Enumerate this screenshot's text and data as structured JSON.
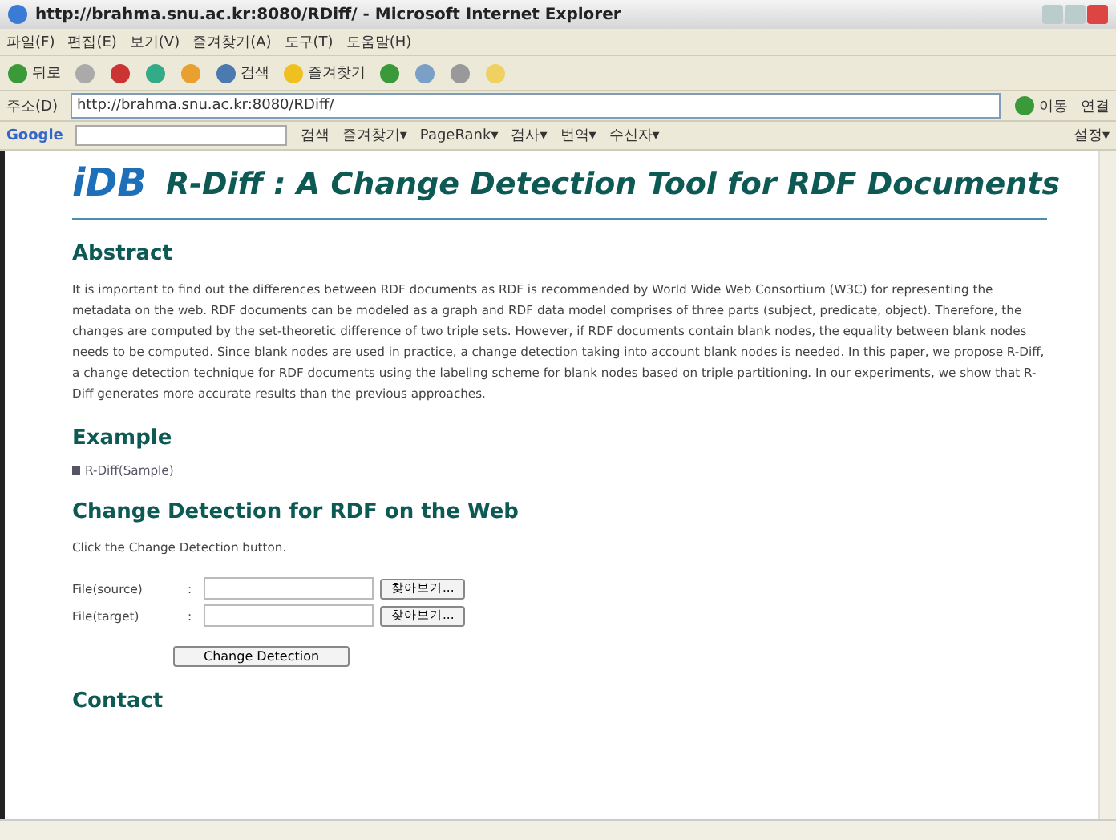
{
  "window": {
    "title": "http://brahma.snu.ac.kr:8080/RDiff/ - Microsoft Internet Explorer"
  },
  "menu": [
    "파일(F)",
    "편집(E)",
    "보기(V)",
    "즐겨찾기(A)",
    "도구(T)",
    "도움말(H)"
  ],
  "toolbar": {
    "back": "뒤로",
    "search": "검색",
    "favorites": "즐겨찾기"
  },
  "address_bar": {
    "label": "주소(D)",
    "value": "http://brahma.snu.ac.kr:8080/RDiff/",
    "go": "이동",
    "links": "연결"
  },
  "google_bar": {
    "brand": "Google",
    "items": [
      "검색",
      "즐겨찾기▾",
      "PageRank▾",
      "검사▾",
      "번역▾",
      "수신자▾"
    ],
    "settings": "설정▾"
  },
  "page": {
    "logo": "iDB",
    "title": "R-Diff : A Change Detection Tool for RDF Documents",
    "sections": [
      {
        "kind": "text",
        "heading": "Abstract",
        "text": "It is important to find out the differences between RDF documents as RDF is recommended by World Wide Web Consortium (W3C) for representing the metadata on the web. RDF documents can be modeled as a graph and RDF data model comprises of three parts (subject, predicate, object). Therefore, the changes are computed by the set-theoretic difference of two triple sets. However, if RDF documents contain blank nodes, the equality between blank nodes needs to be computed. Since blank nodes are used in practice, a change detection taking into account blank nodes is needed. In this paper, we propose R-Diff, a change detection technique for RDF documents using the labeling scheme for blank nodes based on triple partitioning. In our experiments, we show that R-Diff generates more accurate results than the previous approaches."
      },
      {
        "kind": "link",
        "heading": "Example",
        "link": "R-Diff(Sample)"
      },
      {
        "kind": "form",
        "heading": "Change Detection for RDF on the Web",
        "text": "Click the Change Detection button.",
        "fields": [
          {
            "label": "File(source)",
            "separator": ":",
            "browse": "찾아보기..."
          },
          {
            "label": "File(target)",
            "separator": ":",
            "browse": "찾아보기..."
          }
        ],
        "submit": "Change Detection"
      },
      {
        "kind": "heading",
        "heading": "Contact"
      }
    ]
  }
}
